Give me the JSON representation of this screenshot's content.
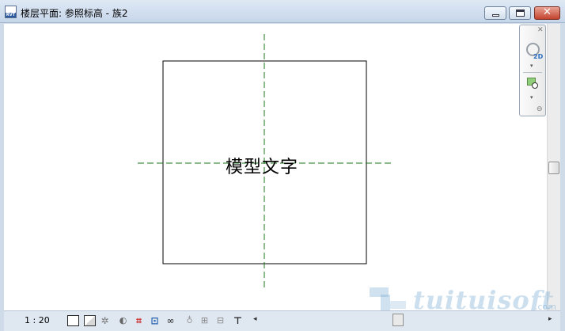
{
  "window": {
    "title": "楼层平面: 参照标高 - 族2",
    "app_icon_label": "RVT",
    "min_glyph": "",
    "max_glyph": "",
    "close_glyph": "✕"
  },
  "canvas": {
    "model_text": "模型文字",
    "square": {
      "stroke": "#000000"
    },
    "reference_line_color": "#1a7a1a"
  },
  "navbar": {
    "close_glyph": "✕",
    "wheel_label": "2D",
    "zoom_icon": "zoom-icon",
    "dropdown_glyph": "▾",
    "bottom_glyph": "⊖"
  },
  "viewbar": {
    "scale": "1 : 20",
    "icons": [
      "detail-level-icon",
      "visual-style-icon",
      "sun-path-icon",
      "shadows-icon",
      "crop-view-icon",
      "show-crop-region-icon",
      "temporary-hide-icon",
      "light-icon",
      "lock-icon",
      "reveal-hidden-icon",
      "constraints-icon"
    ],
    "scroll_left": "◂",
    "scroll_right": "▸"
  },
  "watermark": {
    "text": "tuituisoft",
    "suffix": ".com"
  }
}
